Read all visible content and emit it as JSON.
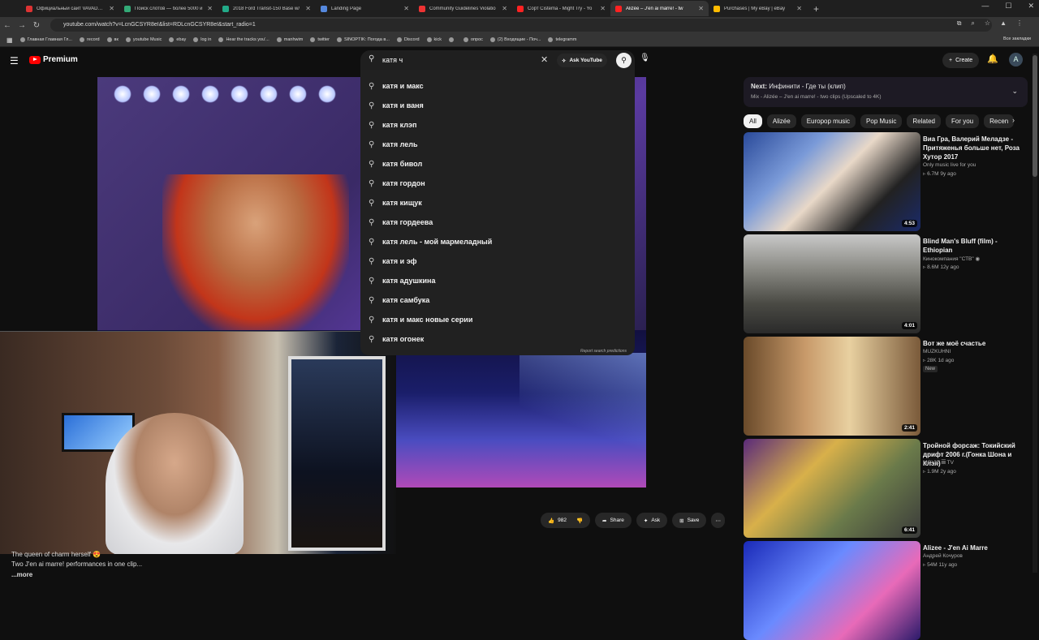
{
  "tabs": [
    {
      "label": "Официальный сайт VAVADA С",
      "color": "#d33"
    },
    {
      "label": "Поиск слотов — более 5000 и",
      "color": "#3a7"
    },
    {
      "label": "2018 Ford Transit-150 Base w/",
      "color": "#2a8"
    },
    {
      "label": "Landing Page",
      "color": "#58d"
    },
    {
      "label": "Community Guidelines Violatio",
      "color": "#e33"
    },
    {
      "label": "Сорт Cistema - Might Try - Yo",
      "color": "#f22"
    },
    {
      "label": "Alizée – J'en ai marre! - tw",
      "color": "#f22"
    },
    {
      "label": "Purchases | My eBay | eBay",
      "color": "#fb0"
    }
  ],
  "address": {
    "url": "youtube.com/watch?v=LcnGCSYR8eI&list=RDLcnGCSYR8eI&start_radio=1"
  },
  "bookmarks": [
    "Главная Главная Гл...",
    "record",
    "вк",
    "youtube Music",
    "ebay",
    "log in",
    "Hear the tracks you'...",
    "manhwim",
    "twitter",
    "SINOPTIK: Погода в...",
    "Discord",
    "kick",
    "",
    "опрос",
    "(2) Входящие - Поч...",
    "telegramm"
  ],
  "bookmarks_all": "Все закладки",
  "header": {
    "logo": "Premium",
    "search_value": "катя ч",
    "ask": "Ask YouTube",
    "create": "Create"
  },
  "suggestions": [
    "катя и макс",
    "катя и ваня",
    "катя клэп",
    "катя лель",
    "катя бивол",
    "катя гордон",
    "катя кищук",
    "катя гордеева",
    "катя лель - мой мармеладный",
    "катя и эф",
    "катя адушкина",
    "катя самбука",
    "катя и макс новые серии",
    "катя огонек"
  ],
  "report_label": "Report search predictions",
  "description": {
    "line1": "The queen of charm herself 😍",
    "line2": "Two J'en ai marre! performances in one  clip...",
    "more": "...more"
  },
  "actions": {
    "likes": "982",
    "share": "Share",
    "ask": "Ask",
    "save": "Save"
  },
  "next": {
    "prefix": "Next:",
    "title": "Инфинити - Где ты (клип)",
    "sub": "Mix - Alizée – J'en ai marre! - two clips (Upscaled to 4K)"
  },
  "chips": [
    "All",
    "Alizée",
    "Europop music",
    "Pop Music",
    "Related",
    "For you",
    "Recen"
  ],
  "recs": [
    {
      "title": "Виа Гра, Валерий Меладзе - Притяженья больше нет, Роза Хутор 2017",
      "channel": "Only music live for you",
      "meta": "▹ 6.7M  9y ago",
      "badge": "",
      "duration": "4:53"
    },
    {
      "title": "Blind Man's Bluff (film) - Ethiopian",
      "channel": "Кинокомпания \"СТВ\" ◉",
      "meta": "▹ 8.6M  12y ago",
      "badge": "",
      "duration": "4:01"
    },
    {
      "title": "Вот же моё счастье",
      "channel": "MUZKUHNI",
      "meta": "▹ 28K  1d ago",
      "badge": "New",
      "duration": "2:41"
    },
    {
      "title": "Тройной форсаж: Токийский дрифт 2006 г.(Гонка Шона и Клэя)",
      "channel": "MOVIE 𝄚 TV",
      "meta": "▹ 1.9M  2y ago",
      "badge": "",
      "duration": "6:41"
    },
    {
      "title": "Alizee - J'en Ai Marre",
      "channel": "Андрей Кочуров",
      "meta": "▹ 54M  11y ago",
      "badge": "",
      "duration": ""
    }
  ],
  "colors": {
    "accent": "#ff0000",
    "bg": "#0f0f0f"
  }
}
